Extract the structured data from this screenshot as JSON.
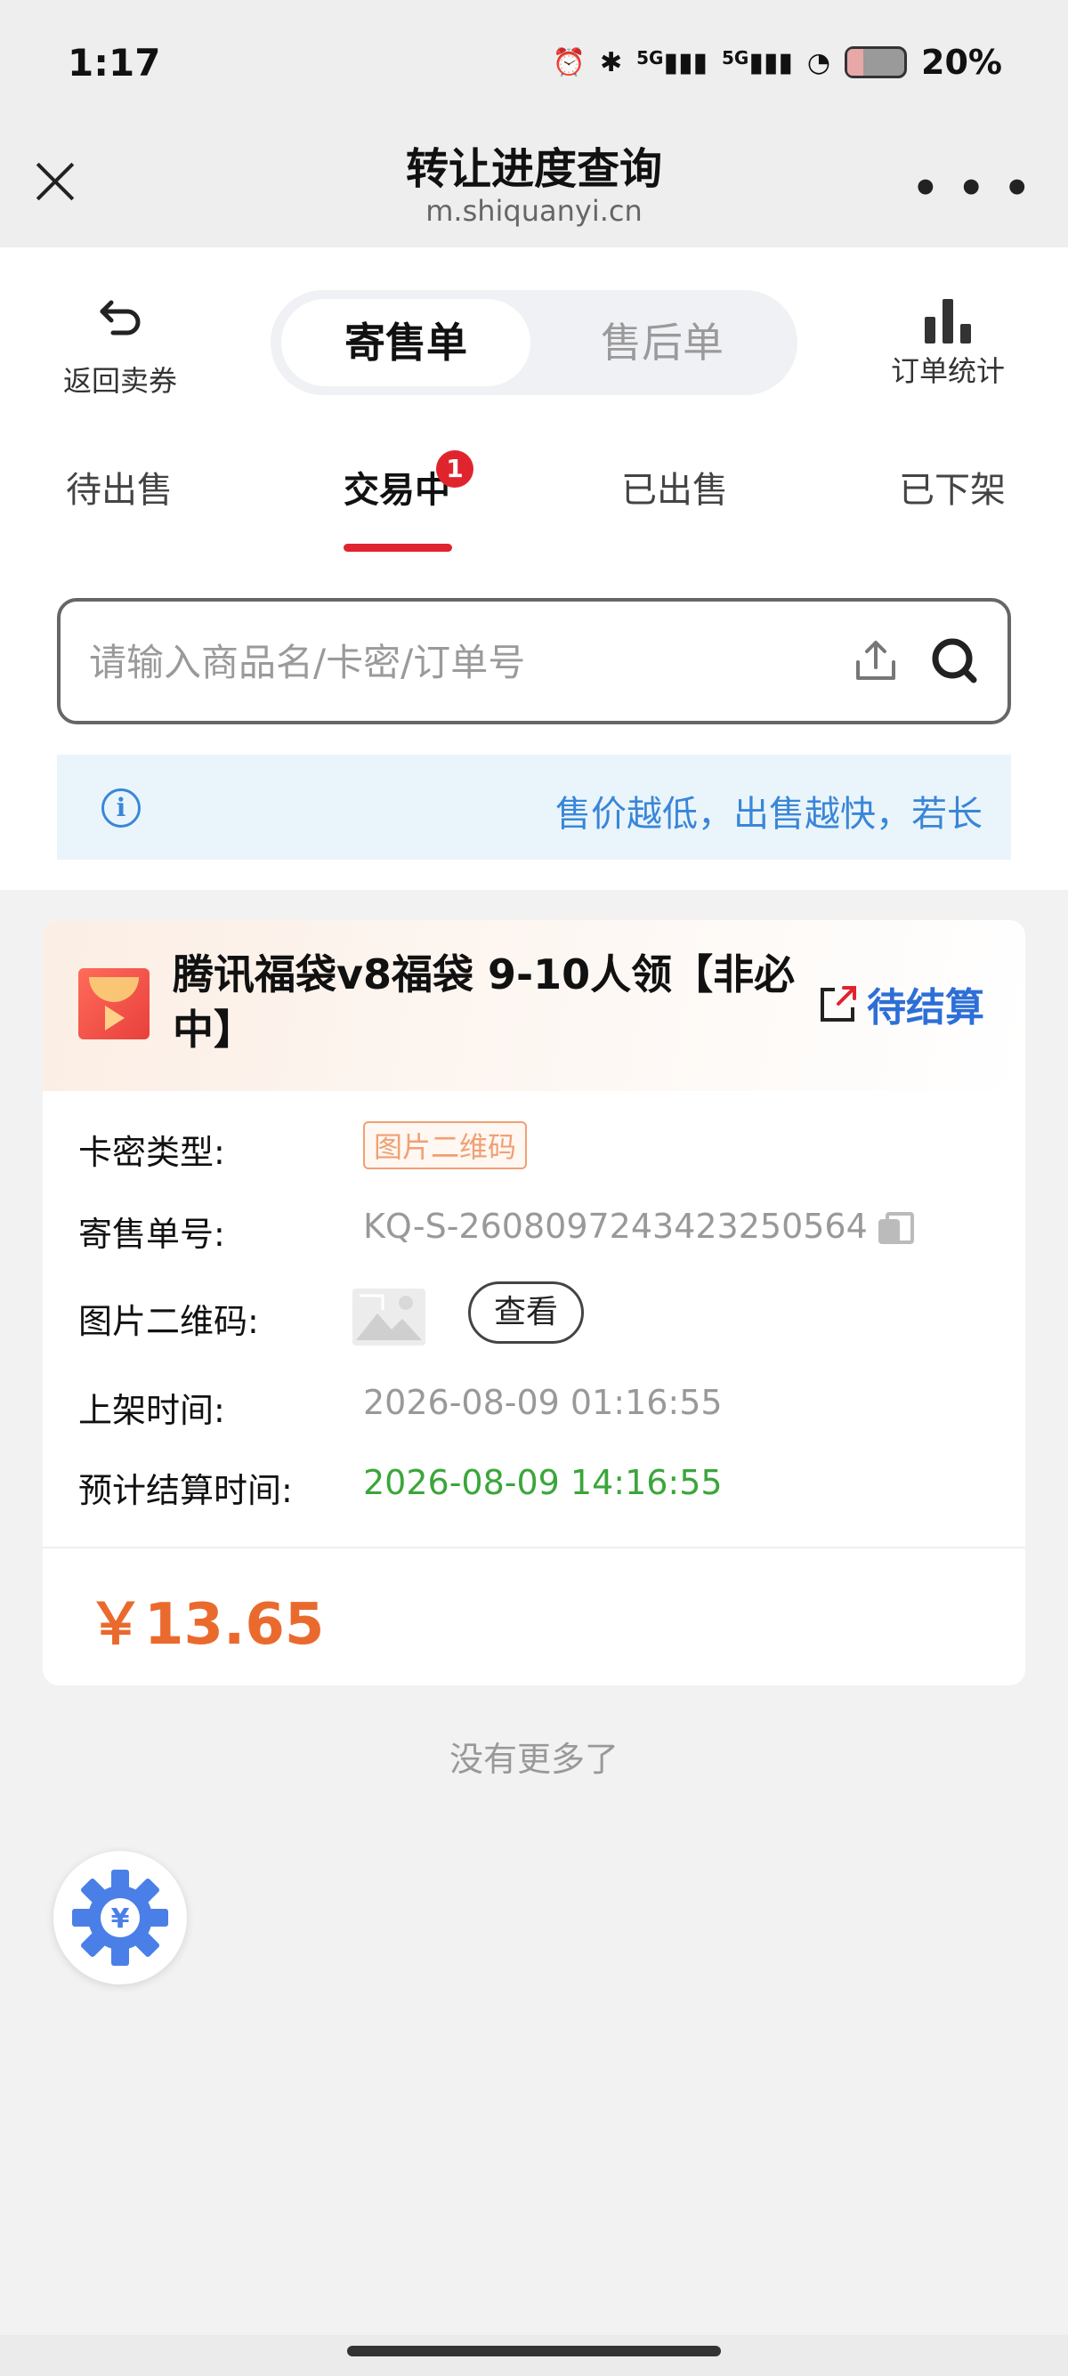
{
  "status_bar": {
    "time": "1:17",
    "signal_1": "5G",
    "signal_2": "5G",
    "battery": "20%"
  },
  "nav": {
    "title": "转让进度查询",
    "url": "m.shiquanyi.cn"
  },
  "header": {
    "back_label": "返回卖券",
    "segments": [
      "寄售单",
      "售后单"
    ],
    "stats_label": "订单统计"
  },
  "tabs": [
    {
      "label": "待出售"
    },
    {
      "label": "交易中",
      "badge": "1"
    },
    {
      "label": "已出售"
    },
    {
      "label": "已下架"
    }
  ],
  "search": {
    "placeholder": "请输入商品名/卡密/订单号"
  },
  "notice": {
    "text": "售价越低，出售越快，若长时间未售出，建议适当降价"
  },
  "order": {
    "title": "腾讯福袋v8福袋 9-10人领【非必中】",
    "status": "待结算",
    "fields": {
      "card_type_label": "卡密类型:",
      "card_type_value": "图片二维码",
      "order_no_label": "寄售单号:",
      "order_no_value": "KQ-S-2608097243423250564",
      "qr_label": "图片二维码:",
      "view_label": "查看",
      "listed_label": "上架时间:",
      "listed_value": "2026-08-09 01:16:55",
      "settle_label": "预计结算时间:",
      "settle_value": "2026-08-09 14:16:55"
    },
    "price": "￥13.65"
  },
  "footer": {
    "no_more": "没有更多了"
  },
  "colors": {
    "accent_red": "#e0242e",
    "status_blue": "#2d6fd6",
    "price_orange": "#ea6a2e",
    "settle_green": "#3aa63a",
    "float_icon_blue": "#4a7fe8"
  }
}
